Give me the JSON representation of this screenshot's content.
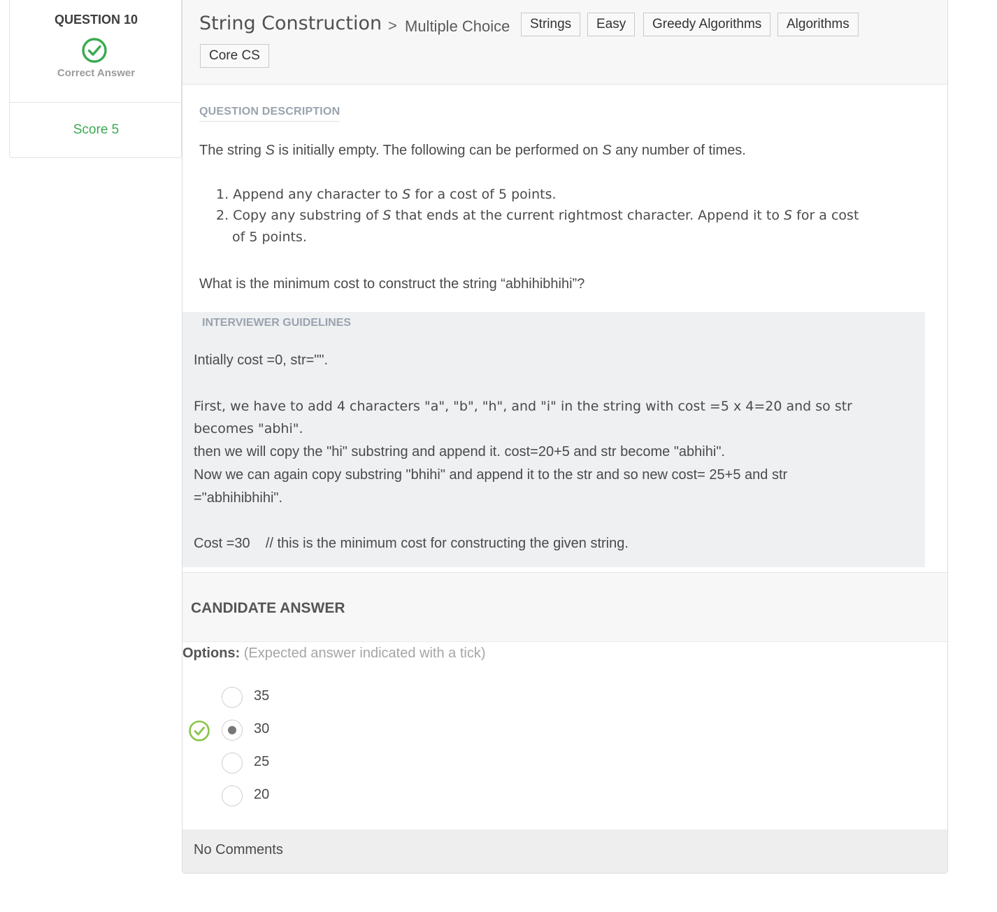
{
  "summary": {
    "question_number": "QUESTION 10",
    "status": "Correct Answer",
    "score": "Score 5"
  },
  "question": {
    "title": "String Construction",
    "chevron": ">",
    "type": "Multiple Choice",
    "tags": [
      "Strings",
      "Easy",
      "Greedy Algorithms",
      "Algorithms",
      "Core CS"
    ]
  },
  "description": {
    "label": "QUESTION DESCRIPTION",
    "intro_a": "The string ",
    "intro_s1": "S",
    "intro_b": " is initially empty.  The following can be performed on ",
    "intro_s2": "S",
    "intro_c": " any number of times.",
    "item1_a": "1. Append any character to ",
    "item1_s": "S",
    "item1_b": " for a cost of 5 points.",
    "item2_a": "2. Copy any substring of ",
    "item2_s1": "S",
    "item2_b": " that ends at the current rightmost character.  Append it to ",
    "item2_s2": "S",
    "item2_c": " for a cost",
    "item2_d": "of 5 points.",
    "question": "What is the minimum cost to construct the string “abhihibhihi”?"
  },
  "guidelines": {
    "label": "INTERVIEWER GUIDELINES",
    "line1": "Intially cost =0, str=\"\".",
    "line2": "First, we have to add 4 characters \"a\", \"b\", \"h\", and \"i\" in the string with cost =5 x 4=20 and so str",
    "line3": "becomes \"abhi\".",
    "line4": "then we will copy the \"hi\" substring and append it. cost=20+5 and str become \"abhihi\".",
    "line5": "Now we can again copy substring \"bhihi\" and append it to the str and so new cost= 25+5 and str",
    "line6": "=\"abhihibhihi\".",
    "line7": "Cost =30    // this is the minimum cost for constructing the given string."
  },
  "candidate": {
    "title": "CANDIDATE ANSWER",
    "options_label": "Options:",
    "options_hint": " (Expected answer indicated with a tick)",
    "options": [
      {
        "label": "35",
        "selected": false,
        "expected": false
      },
      {
        "label": "30",
        "selected": true,
        "expected": true
      },
      {
        "label": "25",
        "selected": false,
        "expected": false
      },
      {
        "label": "20",
        "selected": false,
        "expected": false
      }
    ]
  },
  "comments": "No Comments",
  "colors": {
    "success_green": "#3aaa50",
    "tick_green": "#8bc34a",
    "muted_label": "#9aa3ad"
  }
}
